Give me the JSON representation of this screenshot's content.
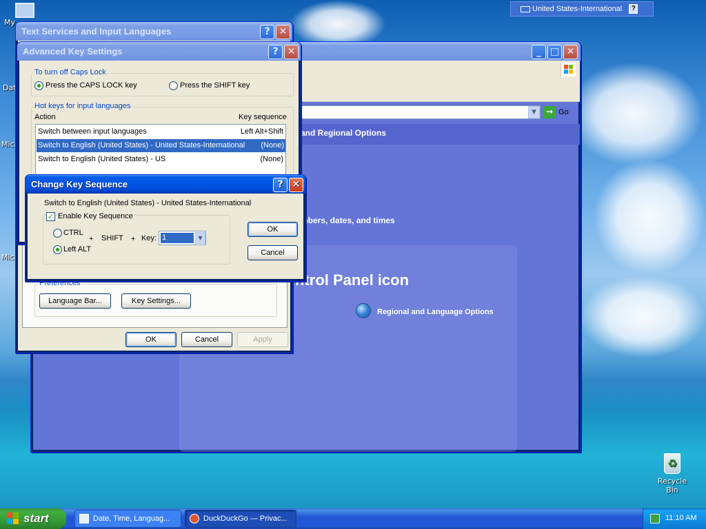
{
  "desktop": {
    "icons": [
      "My",
      "Dat",
      "Micro",
      "Micro",
      "Recycle Bin"
    ]
  },
  "language_bar": {
    "language": "United States-International",
    "help": "?"
  },
  "control_panel": {
    "go_label": "Go",
    "crumb": "and Regional Options",
    "pick_task": "mbers, dates, and times",
    "pick_icon_heading": "ntrol Panel icon",
    "item": "Regional and Language Options"
  },
  "text_services": {
    "title": "Text Services and Input Languages",
    "preferences_label": "Preferences",
    "language_bar_button": "Language Bar...",
    "key_settings_button": "Key Settings...",
    "ok": "OK",
    "cancel": "Cancel",
    "apply": "Apply"
  },
  "advanced_key": {
    "title": "Advanced Key Settings",
    "caps_group": "To turn off Caps Lock",
    "caps_option": "Press the CAPS LOCK key",
    "shift_option": "Press the SHIFT key",
    "hotkeys_group": "Hot keys for input languages",
    "col_action": "Action",
    "col_sequence": "Key sequence",
    "rows": [
      {
        "action": "Switch between input languages",
        "sequence": "Left Alt+Shift"
      },
      {
        "action": "Switch to English (United States) - United States-International",
        "sequence": "(None)"
      },
      {
        "action": "Switch to English (United States) - US",
        "sequence": "(None)"
      }
    ]
  },
  "change_key": {
    "title": "Change Key Sequence",
    "subtitle": "Switch to English (United States) - United States-International",
    "enable_label": "Enable Key Sequence",
    "ctrl_label": "CTRL",
    "left_alt_label": "Left ALT",
    "plus": "+",
    "shift_label": "SHIFT",
    "key_label": "Key:",
    "key_value": "1",
    "ok": "OK",
    "cancel": "Cancel"
  },
  "taskbar": {
    "start": "start",
    "tasks": [
      "Date, Time, Languag...",
      "DuckDuckGo — Privac..."
    ],
    "clock": "11:10 AM"
  }
}
